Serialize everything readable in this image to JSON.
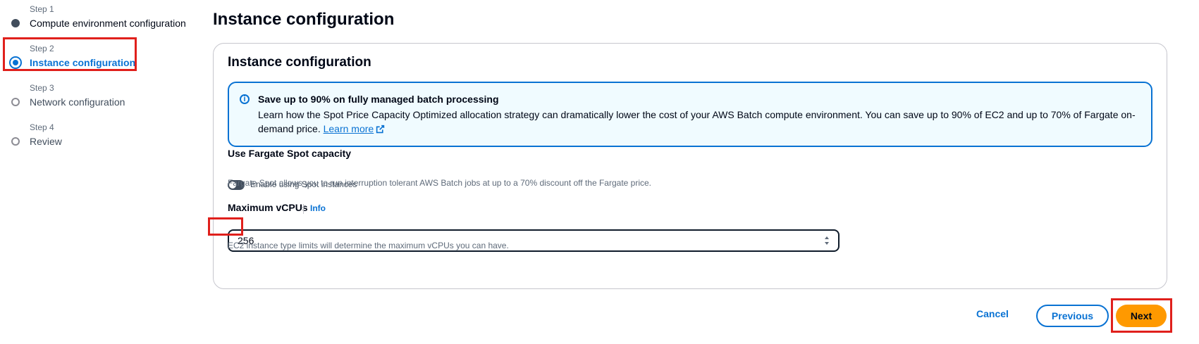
{
  "wizard": {
    "steps": [
      {
        "num": "Step 1",
        "label": "Compute environment configuration",
        "state": "done"
      },
      {
        "num": "Step 2",
        "label": "Instance configuration",
        "state": "active"
      },
      {
        "num": "Step 3",
        "label": "Network configuration",
        "state": "pending"
      },
      {
        "num": "Step 4",
        "label": "Review",
        "state": "pending"
      }
    ]
  },
  "page": {
    "title": "Instance configuration"
  },
  "panel": {
    "title": "Instance configuration",
    "alert": {
      "icon": "info-icon",
      "title": "Save up to 90% on fully managed batch processing",
      "body": "Learn how the Spot Price Capacity Optimized allocation strategy can dramatically lower the cost of your AWS Batch compute environment. You can save up to 90% of EC2 and up to 70% of Fargate on-demand price.",
      "link": "Learn more"
    },
    "fargate_spot": {
      "label": "Use Fargate Spot capacity",
      "toggle_label": "Enable using Spot instances",
      "toggle_on": false,
      "description": "Fargate Spot allows you to run interruption tolerant AWS Batch jobs at up to a 70% discount off the Fargate price."
    },
    "max_vcpus": {
      "label": "Maximum vCPUs",
      "info": "Info",
      "value": "256",
      "description": "EC2 instance type limits will determine the maximum vCPUs you can have."
    }
  },
  "footer": {
    "cancel": "Cancel",
    "previous": "Previous",
    "next": "Next"
  },
  "colors": {
    "accent": "#0972d3",
    "primary_button": "#ff9900",
    "highlight": "#e0201c"
  }
}
